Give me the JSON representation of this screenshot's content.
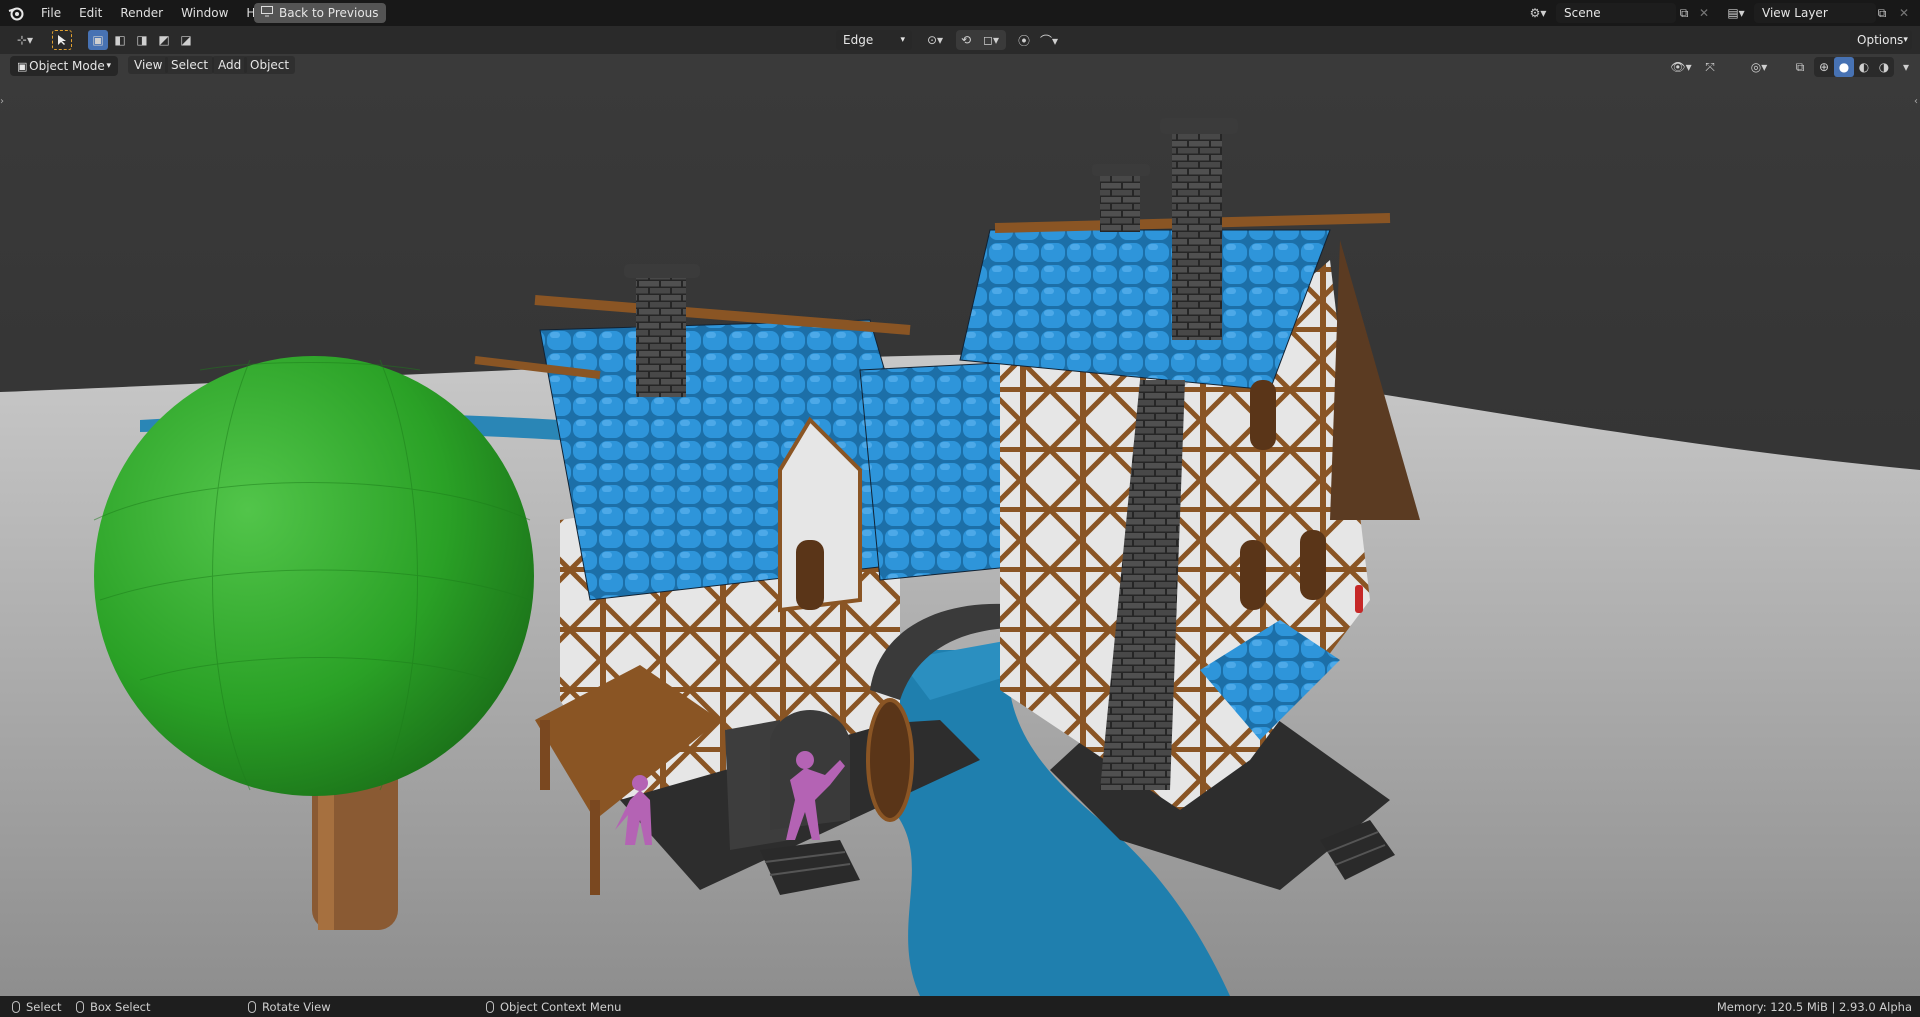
{
  "topbar": {
    "menus": [
      "File",
      "Edit",
      "Render",
      "Window",
      "Help"
    ],
    "back_button": "Back to Previous",
    "scene": {
      "value": "Scene"
    },
    "view_layer": {
      "value": "View Layer"
    }
  },
  "toolbar": {
    "snap_target": "Edge",
    "options_label": "Options"
  },
  "viewport_header": {
    "mode": "Object Mode",
    "menus": [
      "View",
      "Select",
      "Add",
      "Object"
    ]
  },
  "statusbar": {
    "items": [
      {
        "label": "Select"
      },
      {
        "label": "Box Select"
      },
      {
        "label": "Rotate View"
      },
      {
        "label": "Object Context Menu"
      }
    ],
    "info": "Memory: 120.5 MiB | 2.93.0 Alpha"
  },
  "colors": {
    "roof": "#2b8fd4",
    "timber": "#8a5524",
    "stone": "#3a3a3a",
    "tree_foliage": "#2fa82a",
    "water": "#1f7fae",
    "ground": "#9c9c9c",
    "characters": "#b463b4"
  },
  "icons": [
    "blender-logo-icon",
    "back-icon",
    "editor-type-icon",
    "select-box-icon",
    "snap-icon",
    "proportional-icon",
    "overlay-icon",
    "gizmo-icon",
    "xray-icon",
    "shading-wireframe-icon",
    "shading-solid-icon",
    "shading-material-icon",
    "shading-rendered-icon"
  ]
}
